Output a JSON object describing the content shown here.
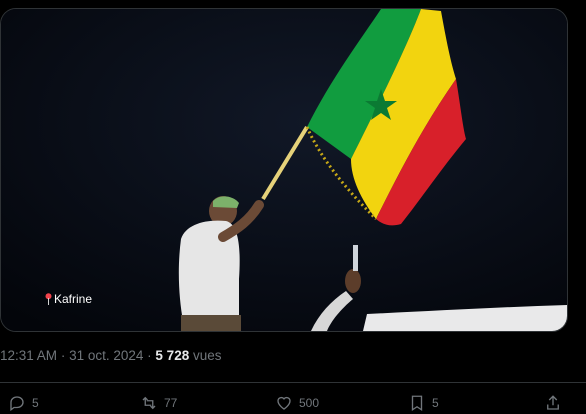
{
  "media": {
    "location_label": "Kafrine",
    "pin_icon": "location-pin-icon"
  },
  "meta": {
    "time": "12:31 AM",
    "separator": "·",
    "date": "31 oct. 2024",
    "views_count": "5 728",
    "views_label": "vues"
  },
  "actions": {
    "replies": "5",
    "reposts": "77",
    "likes": "500",
    "bookmarks": "5"
  },
  "colors": {
    "flag_green": "#119c3f",
    "flag_yellow": "#f2d40f",
    "flag_red": "#d8202a",
    "accent_text": "#71767b"
  }
}
